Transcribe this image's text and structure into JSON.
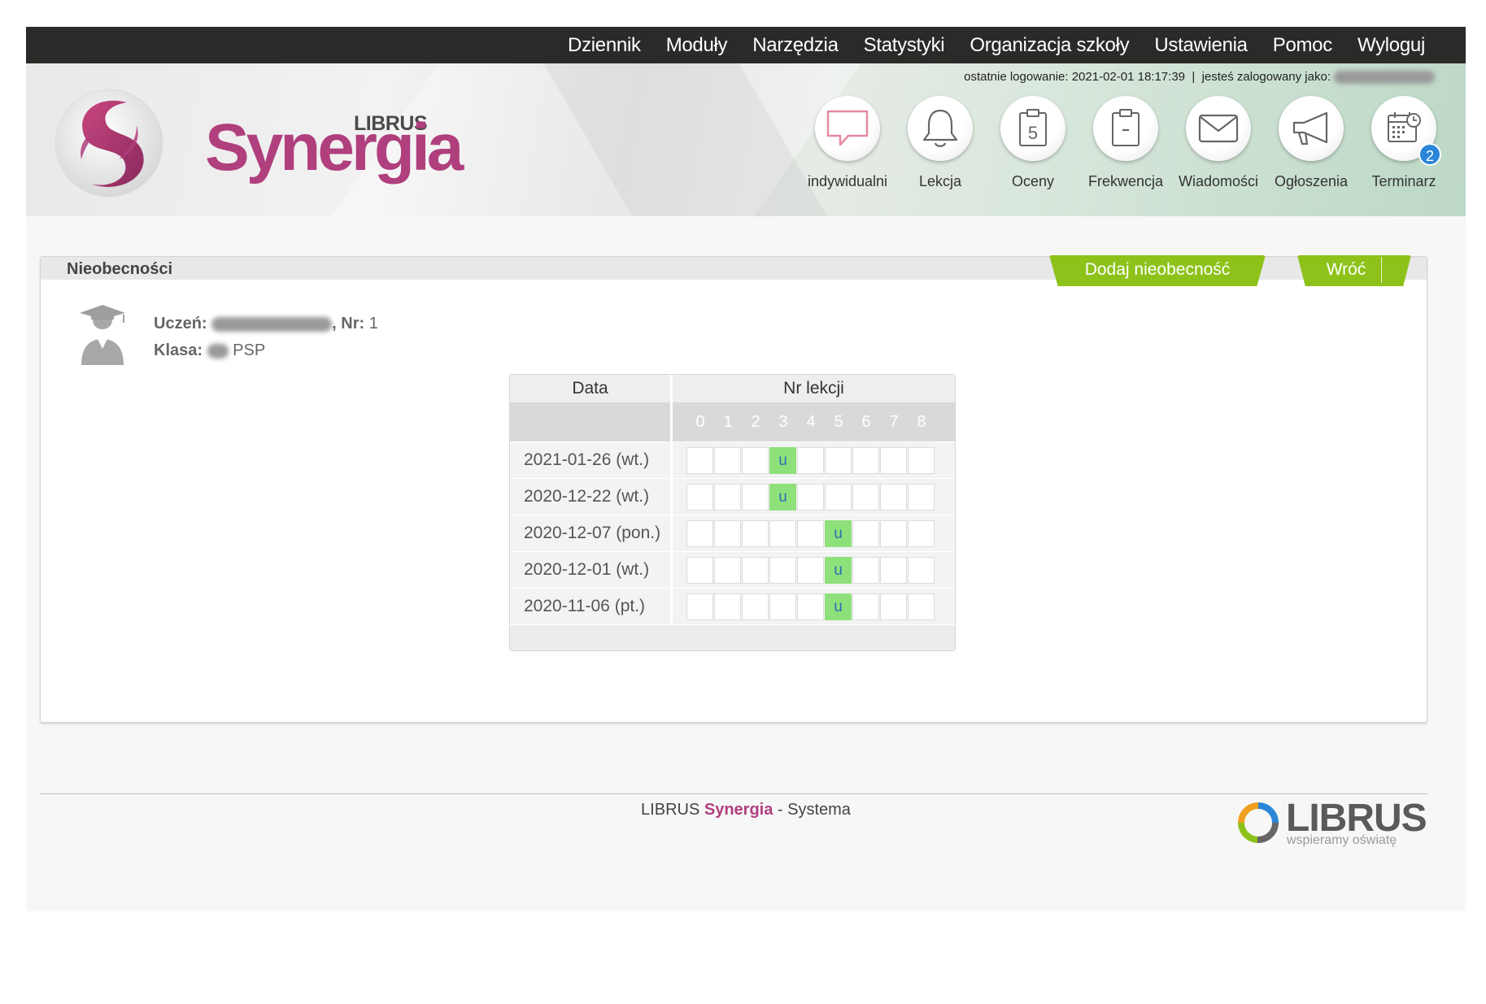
{
  "menu": {
    "items": [
      {
        "label": "Dziennik"
      },
      {
        "label": "Moduły"
      },
      {
        "label": "Narzędzia"
      },
      {
        "label": "Statystyki"
      },
      {
        "label": "Organizacja szkoły"
      },
      {
        "label": "Ustawienia"
      },
      {
        "label": "Pomoc"
      },
      {
        "label": "Wyloguj"
      }
    ]
  },
  "header": {
    "last_login": "ostatnie logowanie: 2021-02-01 18:17:39  |  jesteś zalogowany jako:",
    "logo_brand": "LIBRUS",
    "logo_name": "Synergia",
    "icons": [
      {
        "label": "indywidualni",
        "icon": "speech-bubble-icon"
      },
      {
        "label": "Lekcja",
        "icon": "bell-icon"
      },
      {
        "label": "Oceny",
        "icon": "grades-icon"
      },
      {
        "label": "Frekwencja",
        "icon": "clipboard-icon"
      },
      {
        "label": "Wiadomości",
        "icon": "envelope-icon"
      },
      {
        "label": "Ogłoszenia",
        "icon": "megaphone-icon"
      },
      {
        "label": "Terminarz",
        "icon": "calendar-icon",
        "badge": "2"
      }
    ]
  },
  "panel": {
    "title": "Nieobecności",
    "add_button": "Dodaj nieobecność",
    "back_button": "Wróć",
    "student_label": "Uczeń:",
    "nr_label": ", Nr:",
    "nr_value": "1",
    "class_label": "Klasa:",
    "class_value": "PSP"
  },
  "table": {
    "col_date": "Data",
    "col_lesson": "Nr lekcji",
    "lesson_numbers": [
      "0",
      "1",
      "2",
      "3",
      "4",
      "5",
      "6",
      "7",
      "8"
    ],
    "rows": [
      {
        "date": "2021-01-26 (wt.)",
        "cells": [
          "",
          "",
          "",
          "u",
          "",
          "",
          "",
          "",
          ""
        ]
      },
      {
        "date": "2020-12-22 (wt.)",
        "cells": [
          "",
          "",
          "",
          "u",
          "",
          "",
          "",
          "",
          ""
        ]
      },
      {
        "date": "2020-12-07 (pon.)",
        "cells": [
          "",
          "",
          "",
          "",
          "",
          "u",
          "",
          "",
          ""
        ]
      },
      {
        "date": "2020-12-01 (wt.)",
        "cells": [
          "",
          "",
          "",
          "",
          "",
          "u",
          "",
          "",
          ""
        ]
      },
      {
        "date": "2020-11-06 (pt.)",
        "cells": [
          "",
          "",
          "",
          "",
          "",
          "u",
          "",
          "",
          ""
        ]
      }
    ]
  },
  "footer": {
    "prefix": "LIBRUS",
    "name": "Synergia",
    "suffix": "- Systema",
    "logo_word": "LIBRUS",
    "logo_tagline": "wspieramy oświatę"
  },
  "colors": {
    "accent_green": "#8dc21a",
    "brand_magenta": "#b03f7e",
    "absence_green": "#8ee07a",
    "topbar": "#2a2a28"
  }
}
